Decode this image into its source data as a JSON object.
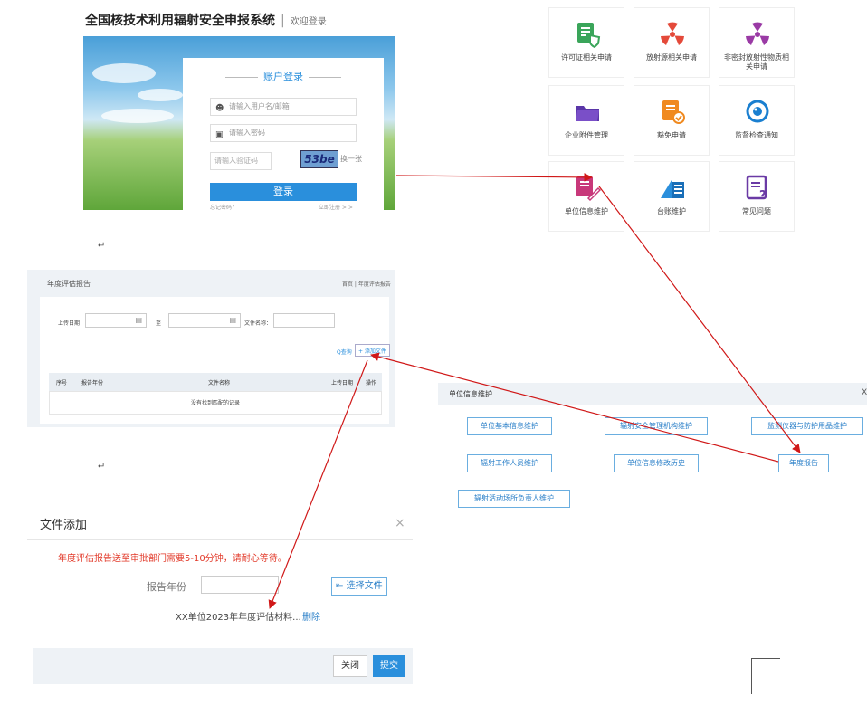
{
  "login": {
    "system_title": "全国核技术利用辐射安全申报系统",
    "separator": "|",
    "welcome": "欢迎登录",
    "box_title": "账户登录",
    "username_placeholder": "请输入用户名/邮箱",
    "password_placeholder": "请输入密码",
    "captcha_placeholder": "请输入验证码",
    "captcha_text": "53be",
    "refresh_text": "换一张",
    "login_button": "登录",
    "forgot_link": "忘记密码？",
    "register_link": "立即注册 > >"
  },
  "tiles": [
    {
      "label": "许可证相关申请",
      "icon": "license-icon",
      "color": "#3aa55a"
    },
    {
      "label": "放射源相关申请",
      "icon": "radiation-source-icon",
      "color": "#e44a3a"
    },
    {
      "label": "非密封放射性物质相关申请",
      "icon": "radiation-material-icon",
      "color": "#9a3aa5"
    },
    {
      "label": "企业附件管理",
      "icon": "folder-icon",
      "color": "#7a4fc8"
    },
    {
      "label": "豁免申请",
      "icon": "exemption-icon",
      "color": "#f08a20"
    },
    {
      "label": "监督检查通知",
      "icon": "eye-icon",
      "color": "#1a7fd0"
    },
    {
      "label": "单位信息维护",
      "icon": "unit-info-icon",
      "color": "#c8387a"
    },
    {
      "label": "台账维护",
      "icon": "ledger-icon",
      "color": "#2a8fdc"
    },
    {
      "label": "常见问题",
      "icon": "faq-icon",
      "color": "#6a3aa5"
    }
  ],
  "newline_mark": "↵",
  "eval_list": {
    "title": "年度评估报告",
    "breadcrumb": "首页 | 年度评估报告",
    "upload_date_label": "上传日期：",
    "to_label": "至",
    "file_name_label": "文件名称：",
    "query_button": "Q查询",
    "add_button": "+ 添加文件",
    "columns": [
      "序号",
      "报告年份",
      "文件名称",
      "上传日期",
      "操作"
    ],
    "empty_text": "没有找到匹配的记录"
  },
  "unit_info": {
    "title": "单位信息维护",
    "close": "X",
    "buttons": [
      "单位基本信息维护",
      "辐射安全管理机构维护",
      "监测仪器与防护用品维护",
      "辐射工作人员维护",
      "单位信息修改历史",
      "年度报告",
      "辐射活动场所负责人维护"
    ]
  },
  "file_dialog": {
    "title": "文件添加",
    "close": "×",
    "warning": "年度评估报告送至审批部门需要5-10分钟，请耐心等待。",
    "year_label": "报告年份",
    "choose_button": "选择文件",
    "file_name": "XX单位2023年年度评估材料...",
    "delete_link": "删除",
    "close_button": "关闭",
    "submit_button": "提交"
  },
  "colors": {
    "accent": "#2a8fdc",
    "arrow": "#d01818",
    "warning": "#e23a2a"
  }
}
